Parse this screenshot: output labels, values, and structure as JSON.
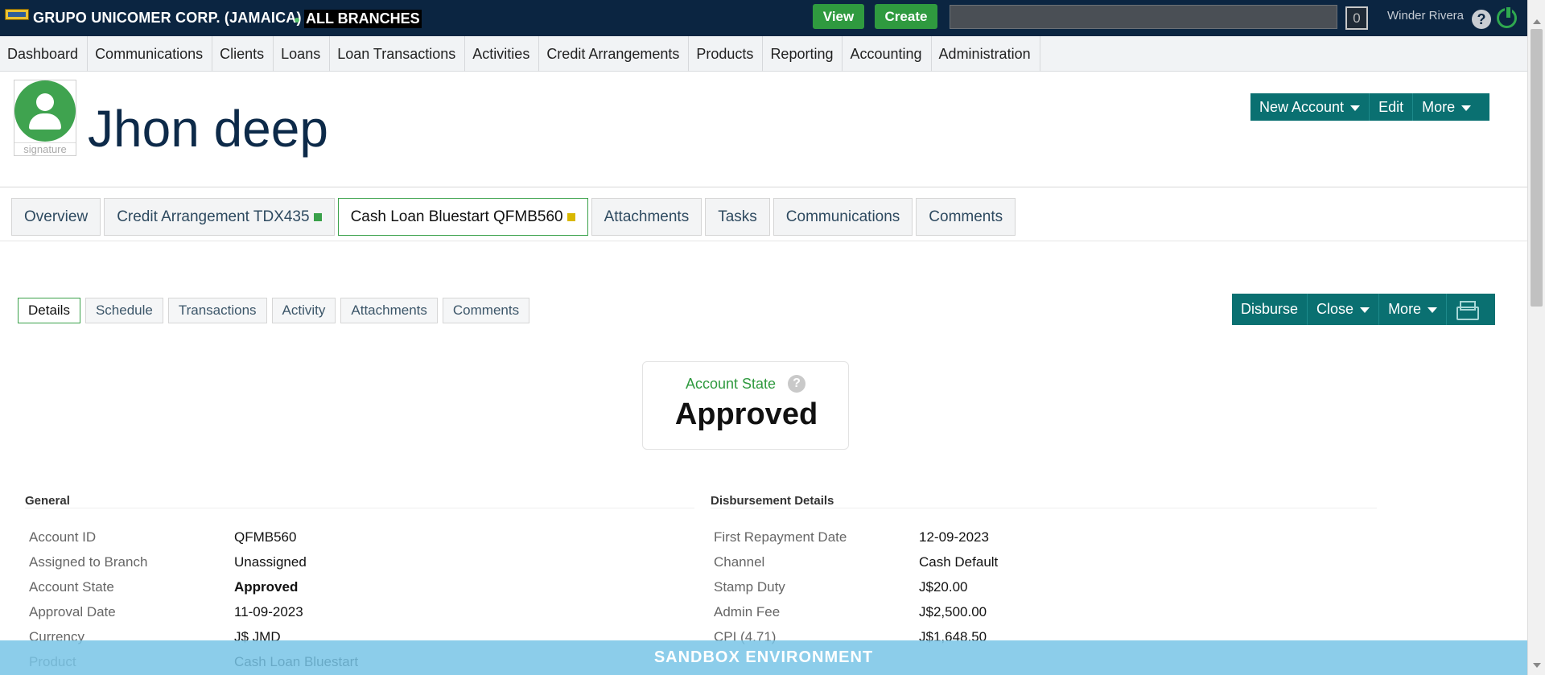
{
  "topbar": {
    "org": "GRUPO UNICOMER CORP. (JAMAICA)",
    "branches": "ALL BRANCHES",
    "view_label": "View",
    "create_label": "Create",
    "search_value": "",
    "notifications_count": "0",
    "user_name": "Winder Rivera",
    "help_glyph": "?"
  },
  "nav": [
    "Dashboard",
    "Communications",
    "Clients",
    "Loans",
    "Loan Transactions",
    "Activities",
    "Credit Arrangements",
    "Products",
    "Reporting",
    "Accounting",
    "Administration"
  ],
  "client": {
    "name": "Jhon deep",
    "signature_label": "signature"
  },
  "header_actions": {
    "new_account": "New Account",
    "edit": "Edit",
    "more": "More"
  },
  "tabs": [
    {
      "label": "Overview",
      "marker": ""
    },
    {
      "label": "Credit Arrangement TDX435",
      "marker": "#3aa14a"
    },
    {
      "label": "Cash Loan Bluestart QFMB560",
      "marker": "#d9b800"
    },
    {
      "label": "Attachments",
      "marker": ""
    },
    {
      "label": "Tasks",
      "marker": ""
    },
    {
      "label": "Communications",
      "marker": ""
    },
    {
      "label": "Comments",
      "marker": ""
    }
  ],
  "active_tab_index": 2,
  "subtabs": [
    "Details",
    "Schedule",
    "Transactions",
    "Activity",
    "Attachments",
    "Comments"
  ],
  "active_subtab_index": 0,
  "loan_actions": {
    "disburse": "Disburse",
    "close": "Close",
    "more": "More",
    "print_icon": "printer-icon"
  },
  "account_state": {
    "label": "Account State",
    "help_glyph": "?",
    "value": "Approved"
  },
  "general": {
    "title": "General",
    "rows": [
      {
        "key": "Account ID",
        "value": "QFMB560",
        "bold": false
      },
      {
        "key": "Assigned to Branch",
        "value": "Unassigned",
        "bold": false
      },
      {
        "key": "Account State",
        "value": "Approved",
        "bold": true
      },
      {
        "key": "Approval Date",
        "value": "11-09-2023",
        "bold": false
      },
      {
        "key": "Currency",
        "value": "J$ JMD",
        "bold": false
      },
      {
        "key": "Product",
        "value": "Cash Loan Bluestart",
        "bold": false
      }
    ]
  },
  "disbursement": {
    "title": "Disbursement Details",
    "rows": [
      {
        "key": "First Repayment Date",
        "value": "12-09-2023"
      },
      {
        "key": "Channel",
        "value": "Cash Default"
      },
      {
        "key": "Stamp Duty",
        "value": "J$20.00"
      },
      {
        "key": "Admin Fee",
        "value": "J$2,500.00"
      },
      {
        "key": "CPI (4.71)",
        "value": "J$1,648.50"
      }
    ]
  },
  "sandbox_banner": "SANDBOX ENVIRONMENT",
  "colors": {
    "topbar": "#0b2541",
    "accent_teal": "#0a7071",
    "accent_green": "#2f9a3f",
    "sandbox": "#78c4e6"
  }
}
